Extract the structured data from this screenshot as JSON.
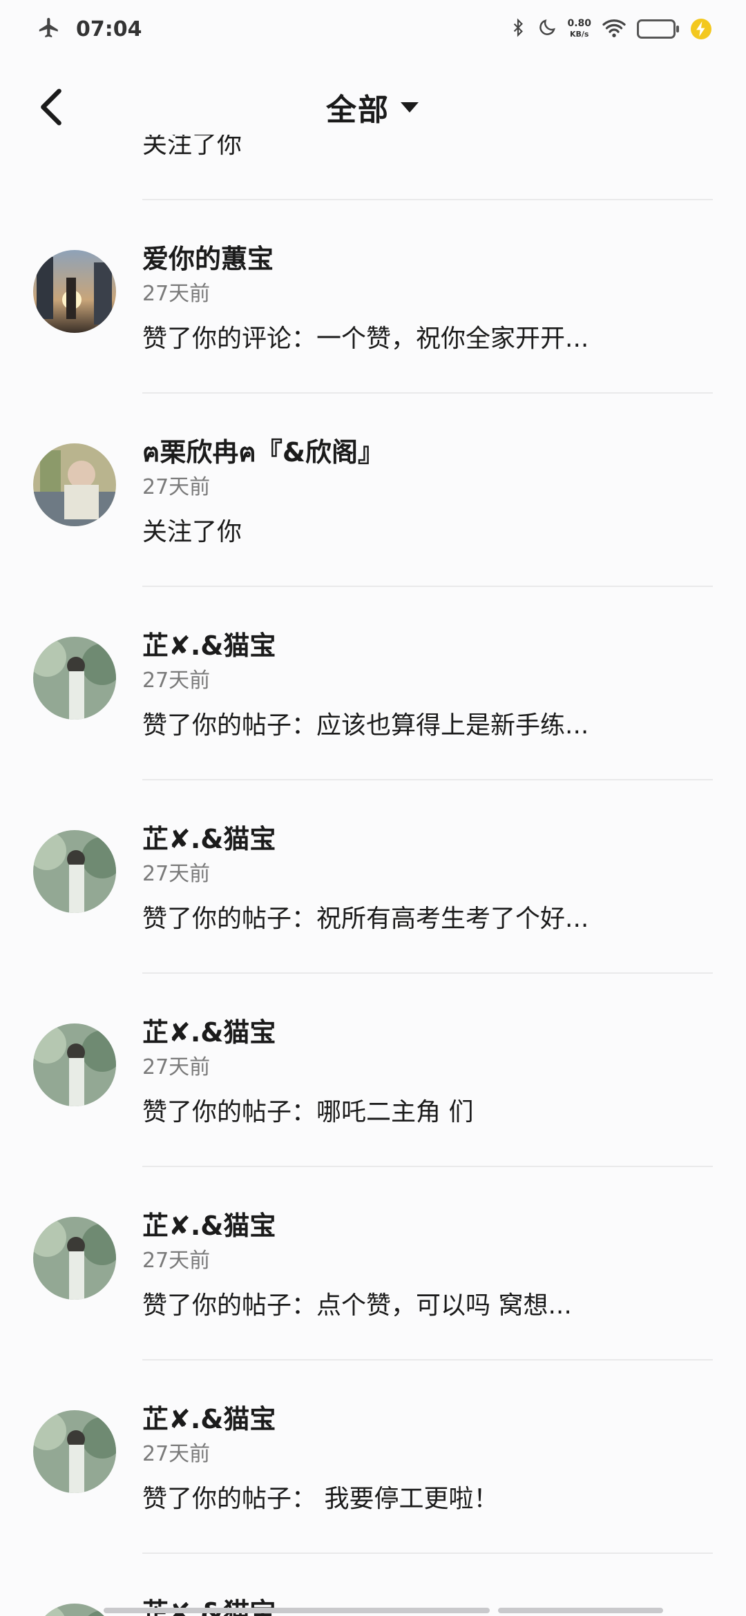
{
  "status_bar": {
    "time": "07:04",
    "net_speed_value": "0.80",
    "net_speed_unit": "KB/s",
    "icons": [
      "airplane-icon",
      "bluetooth-icon",
      "moon-icon",
      "wifi-icon",
      "battery-icon",
      "charging-icon"
    ]
  },
  "header": {
    "title": "全部",
    "back_icon": "chevron-left-icon",
    "dropdown_icon": "caret-down-icon"
  },
  "partial_top_message": "关注了你",
  "notifications": [
    {
      "name": "爱你的蕙宝",
      "time": "27天前",
      "message": "赞了你的评论：一个赞，祝你全家开开...",
      "avatar": "city-sunset"
    },
    {
      "name": "ฅ栗欣冉ฅ『&欣阁』",
      "time": "27天前",
      "message": "关注了你",
      "avatar": "girl-photo"
    },
    {
      "name": "芷✘.&猫宝",
      "time": "27天前",
      "message": "赞了你的帖子：应该也算得上是新手练...",
      "avatar": "forest-girl"
    },
    {
      "name": "芷✘.&猫宝",
      "time": "27天前",
      "message": "赞了你的帖子：祝所有高考生考了个好...",
      "avatar": "forest-girl"
    },
    {
      "name": "芷✘.&猫宝",
      "time": "27天前",
      "message": "赞了你的帖子：哪吒二主角 们",
      "avatar": "forest-girl"
    },
    {
      "name": "芷✘.&猫宝",
      "time": "27天前",
      "message": "赞了你的帖子：点个赞，可以吗 窝想...",
      "avatar": "forest-girl"
    },
    {
      "name": "芷✘.&猫宝",
      "time": "27天前",
      "message": "赞了你的帖子： 我要停工更啦！",
      "avatar": "forest-girl"
    },
    {
      "name": "芷✘.&猫宝",
      "time": "",
      "message": "",
      "avatar": "forest-girl"
    }
  ]
}
